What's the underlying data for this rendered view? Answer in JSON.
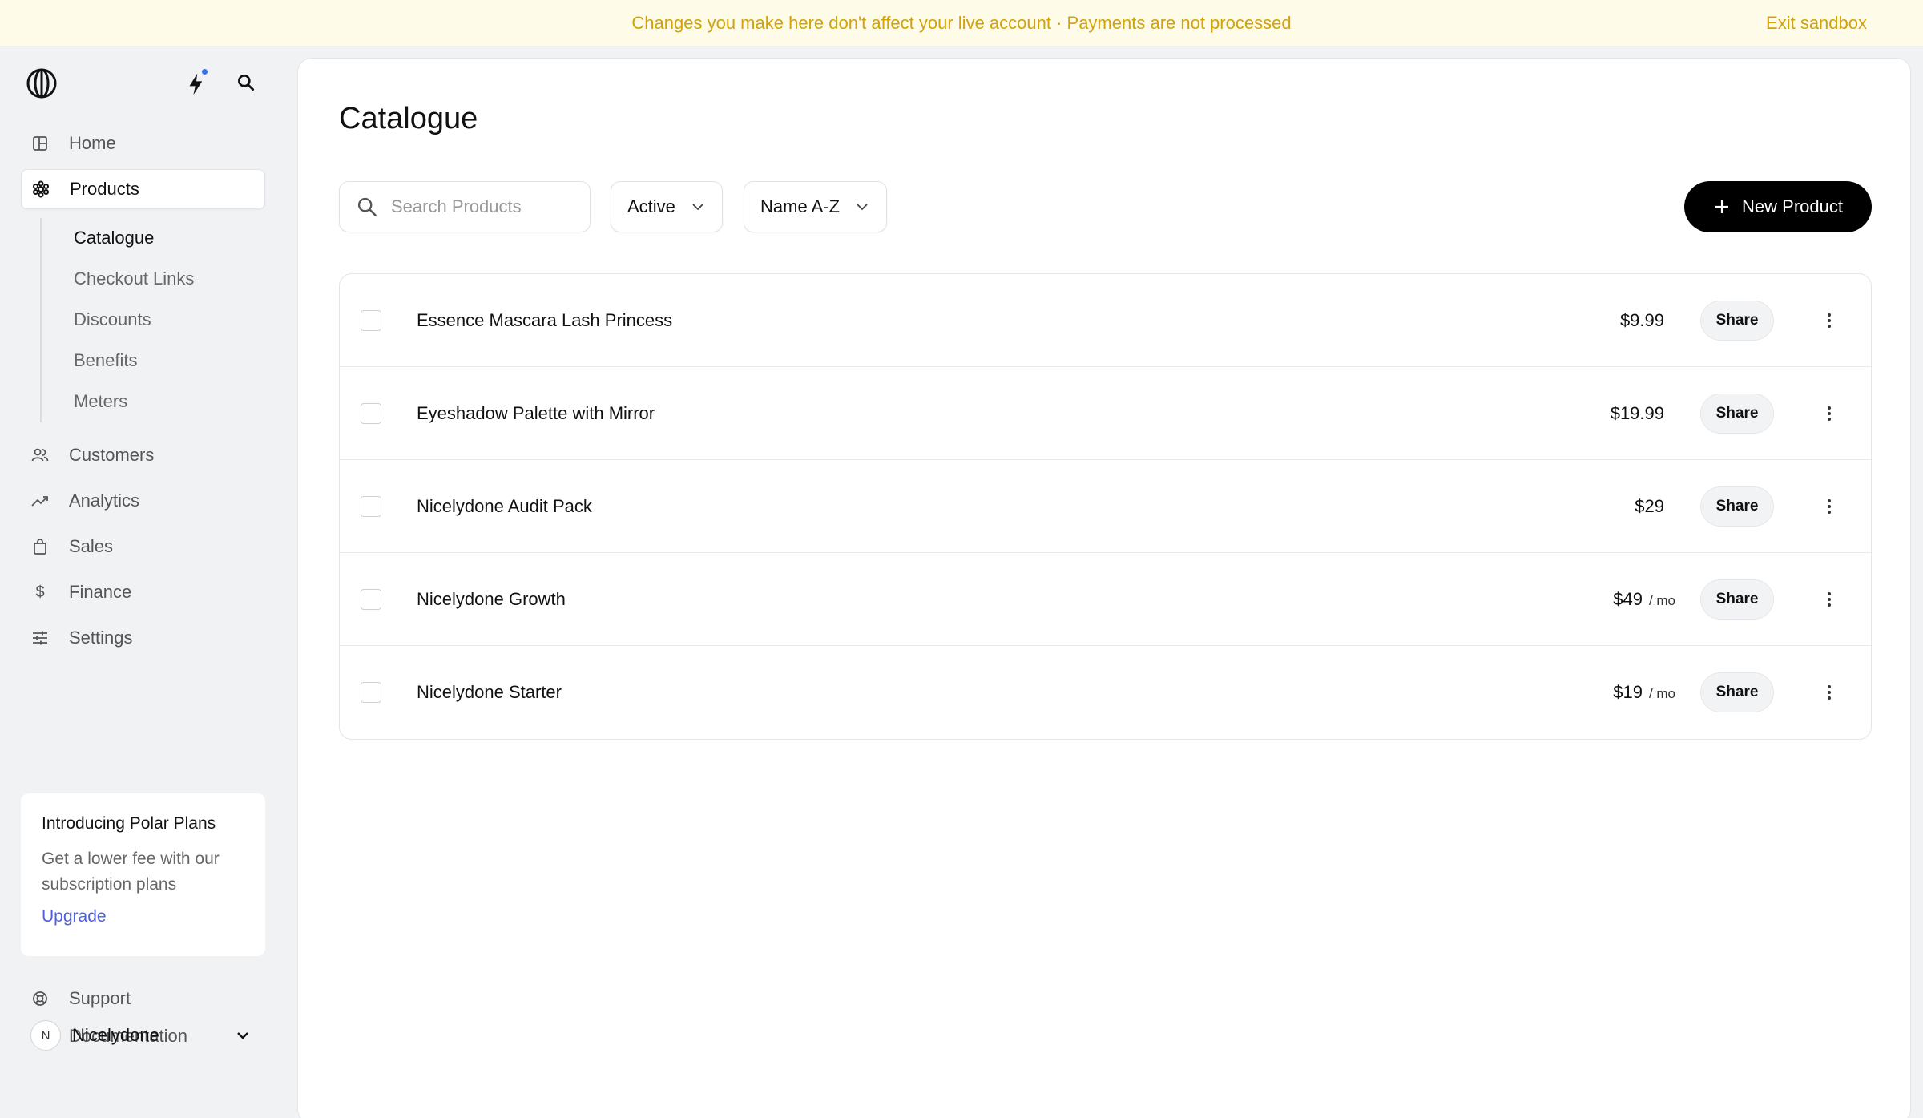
{
  "banner": {
    "message": "Changes you make here don't affect your live account · Payments are not processed",
    "exit_label": "Exit sandbox"
  },
  "sidebar": {
    "nav": [
      {
        "label": "Home",
        "icon": "home-icon"
      },
      {
        "label": "Products",
        "icon": "products-icon",
        "active": true
      },
      {
        "label": "Customers",
        "icon": "customers-icon"
      },
      {
        "label": "Analytics",
        "icon": "analytics-icon"
      },
      {
        "label": "Sales",
        "icon": "sales-icon"
      },
      {
        "label": "Finance",
        "icon": "finance-icon"
      },
      {
        "label": "Settings",
        "icon": "settings-icon"
      }
    ],
    "subnav": [
      {
        "label": "Catalogue",
        "active": true
      },
      {
        "label": "Checkout Links"
      },
      {
        "label": "Discounts"
      },
      {
        "label": "Benefits"
      },
      {
        "label": "Meters"
      }
    ],
    "promo": {
      "title": "Introducing Polar Plans",
      "description": "Get a lower fee with our subscription plans",
      "link": "Upgrade"
    },
    "footer": [
      {
        "label": "Support",
        "icon": "support-icon"
      },
      {
        "label": "Documentation",
        "icon": "external-link-icon"
      }
    ],
    "org": {
      "initial": "N",
      "name": "Nicelydone"
    }
  },
  "main": {
    "title": "Catalogue",
    "search_placeholder": "Search Products",
    "filter_status": "Active",
    "sort": "Name A-Z",
    "new_button": "New Product",
    "share_label": "Share",
    "products": [
      {
        "name": "Essence Mascara Lash Princess",
        "price": "$9.99",
        "per": ""
      },
      {
        "name": "Eyeshadow Palette with Mirror",
        "price": "$19.99",
        "per": ""
      },
      {
        "name": "Nicelydone Audit Pack",
        "price": "$29",
        "per": ""
      },
      {
        "name": "Nicelydone Growth",
        "price": "$49",
        "per": "/ mo"
      },
      {
        "name": "Nicelydone Starter",
        "price": "$19",
        "per": "/ mo"
      }
    ]
  },
  "colors": {
    "banner_text": "#d3a20a",
    "banner_bg": "#fefbe8",
    "link": "#4c5fdd",
    "accent_dot": "#3b6ee6"
  }
}
